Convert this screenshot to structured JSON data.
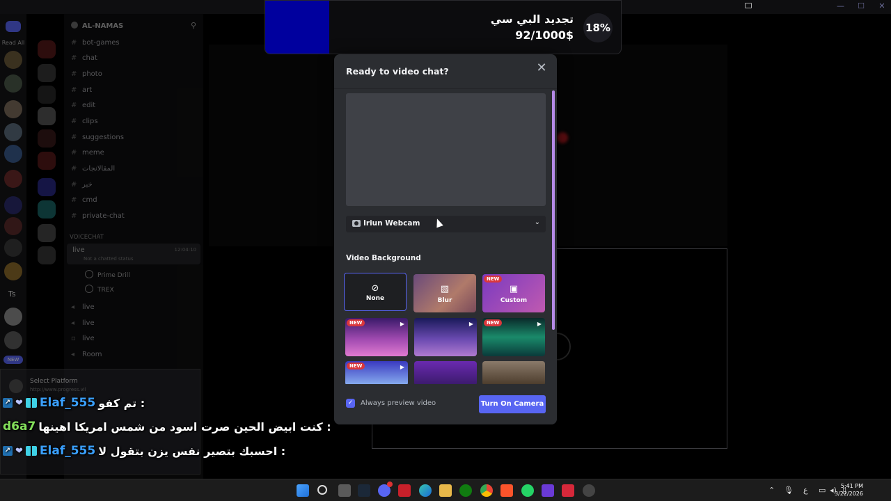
{
  "window": {
    "controls": [
      "—",
      "☐",
      "✕"
    ]
  },
  "rail": {
    "read_all": "Read All",
    "ts_label": "Ts",
    "new_badge": "NEW"
  },
  "server": {
    "name": "AL-NAMAS",
    "channels": [
      {
        "label": "bot-games"
      },
      {
        "label": "chat"
      },
      {
        "label": "photo"
      },
      {
        "label": "art"
      },
      {
        "label": "edit"
      },
      {
        "label": "clips"
      },
      {
        "label": "suggestions"
      },
      {
        "label": "meme"
      },
      {
        "label": "المقالانجات"
      },
      {
        "label": "خبر"
      },
      {
        "label": "cmd"
      },
      {
        "label": "private-chat"
      }
    ],
    "voice_category": "VOICECHAT",
    "live_channel": {
      "label": "live",
      "status": "Not a chatted status",
      "time": "12:04:10"
    },
    "voice_users": [
      "Prime Drill",
      "TREX"
    ],
    "more_channels": [
      "live",
      "live",
      "live",
      "Room"
    ]
  },
  "panel": {
    "platform": "Select Platform",
    "sub": "http://www.progress.vil"
  },
  "chat": [
    {
      "username": "Elaf_555",
      "message": "تم كفو :",
      "style": "blue"
    },
    {
      "username": "d6a7",
      "message": "كنت ابيض الحين صرت اسود من شمس امريكا اهينها :",
      "style": "green"
    },
    {
      "username": "Elaf_555",
      "message": "احسبك بتصير نفس يزن بتقول لا :",
      "style": "blue"
    }
  ],
  "goal": {
    "title": "تجديد البي سي",
    "amount": "92/1000$",
    "percent": "18%",
    "progress": 0.18
  },
  "modal": {
    "title": "Ready to video chat?",
    "close": "✕",
    "camera": "Iriun Webcam",
    "chevron": "⌄",
    "section": "Video Background",
    "tiles": [
      {
        "label": "None",
        "icon": "⊘",
        "new": "",
        "play": ""
      },
      {
        "label": "Blur",
        "icon": "▧",
        "new": "",
        "play": ""
      },
      {
        "label": "Custom",
        "icon": "▣",
        "new": "NEW",
        "play": ""
      },
      {
        "label": "",
        "icon": "",
        "new": "NEW",
        "play": "▶"
      },
      {
        "label": "",
        "icon": "",
        "new": "",
        "play": "▶"
      },
      {
        "label": "",
        "icon": "",
        "new": "NEW",
        "play": "▶"
      },
      {
        "label": "",
        "icon": "",
        "new": "NEW",
        "play": "▶"
      },
      {
        "label": "",
        "icon": "",
        "new": "",
        "play": ""
      },
      {
        "label": "",
        "icon": "",
        "new": "",
        "play": ""
      }
    ],
    "always_preview": "Always preview video",
    "checkbox": "✓",
    "turn_on": "Turn On Camera"
  },
  "taskbar": {
    "badge_count": "9",
    "xbox_badge": "6",
    "tray_lang": "ع",
    "time": "5:41 PM",
    "date": "3/22/2026"
  },
  "colors": {
    "accent": "#5865f2",
    "goal_fill": "#00009e",
    "scroll": "#b58ae8"
  }
}
